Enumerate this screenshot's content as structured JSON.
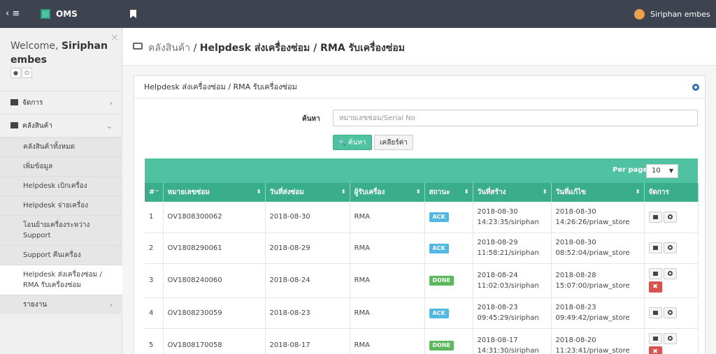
{
  "topbar": {
    "brand": "OMS",
    "user": "Siriphan embes",
    "menu_icon": "≡",
    "toggle_arrow": "‹"
  },
  "sidebar": {
    "welcome_prefix": "Welcome, ",
    "welcome_name": "Siriphan embes",
    "close": "×",
    "menu": [
      {
        "label": "จัดการ",
        "chevron": "›"
      },
      {
        "label": "คลังสินค้า",
        "chevron": "⌄"
      }
    ],
    "submenu": [
      "คลังสินค้าทั้งหมด",
      "เพิ่มข้อมูล",
      "Helpdesk เบิกเครื่อง",
      "Helpdesk จ่ายเครื่อง",
      "โอนย้ายเครื่องระหว่าง Support",
      "Support คืนเครื่อง",
      "Helpdesk ส่งเครื่องซ่อม / RMA รับเครื่องซ่อม"
    ],
    "report": {
      "label": "รายงาน",
      "chevron": "›"
    }
  },
  "header": {
    "crumb": "คลังสินค้า",
    "sep": " / ",
    "current": "Helpdesk ส่งเครื่องซ่อม / RMA รับเครื่องซ่อม"
  },
  "panel": {
    "title": "Helpdesk ส่งเครื่องซ่อม / RMA รับเครื่องซ่อม",
    "search_label": "ค้นหา",
    "search_placeholder": "หมายเลขซ่อม/Serial No",
    "search_button": "ค้นหา",
    "search_button_icon": "🔍",
    "clear_button": "เคลียร์ค่า",
    "per_page_label": "Per page:",
    "per_page_value": "10"
  },
  "table": {
    "columns": [
      "#",
      "หมายเลขซ่อม",
      "วันที่ส่งซ่อม",
      "ผู้รับเครื่อง",
      "สถานะ",
      "วันที่สร้าง",
      "วันที่แก้ไข",
      "จัดการ"
    ],
    "sort_first": "⌃",
    "sort_other": "⬍",
    "rows": [
      {
        "no": "1",
        "repair_no": "OV1808300062",
        "send_date": "2018-08-30",
        "receiver": "RMA",
        "status": "ACK",
        "status_type": "ack",
        "created_1": "2018-08-30",
        "created_2": "14:23:35/siriphan",
        "updated_1": "2018-08-30",
        "updated_2": "14:26:26/priaw_store",
        "delete": false
      },
      {
        "no": "2",
        "repair_no": "OV1808290061",
        "send_date": "2018-08-29",
        "receiver": "RMA",
        "status": "ACK",
        "status_type": "ack",
        "created_1": "2018-08-29",
        "created_2": "11:58:21/siriphan",
        "updated_1": "2018-08-30",
        "updated_2": "08:52:04/priaw_store",
        "delete": false
      },
      {
        "no": "3",
        "repair_no": "OV1808240060",
        "send_date": "2018-08-24",
        "receiver": "RMA",
        "status": "DONE",
        "status_type": "done",
        "created_1": "2018-08-24",
        "created_2": "11:02:03/siriphan",
        "updated_1": "2018-08-28",
        "updated_2": "15:07:00/priaw_store",
        "delete": true
      },
      {
        "no": "4",
        "repair_no": "OV1808230059",
        "send_date": "2018-08-23",
        "receiver": "RMA",
        "status": "ACK",
        "status_type": "ack",
        "created_1": "2018-08-23",
        "created_2": "09:45:29/siriphan",
        "updated_1": "2018-08-23",
        "updated_2": "09:49:42/priaw_store",
        "delete": false
      },
      {
        "no": "5",
        "repair_no": "OV1808170058",
        "send_date": "2018-08-17",
        "receiver": "RMA",
        "status": "DONE",
        "status_type": "done",
        "created_1": "2018-08-17",
        "created_2": "14:31:30/siriphan",
        "updated_1": "2018-08-20",
        "updated_2": "11:23:41/priaw_store",
        "delete": true
      }
    ],
    "delete_glyph": "✖"
  },
  "colors": {
    "topbar": "#3d4450",
    "accent": "#4fc3a1",
    "header_row": "#3aae8b",
    "ack": "#4fb9e3",
    "done": "#5cb85c",
    "danger": "#d9534f"
  }
}
